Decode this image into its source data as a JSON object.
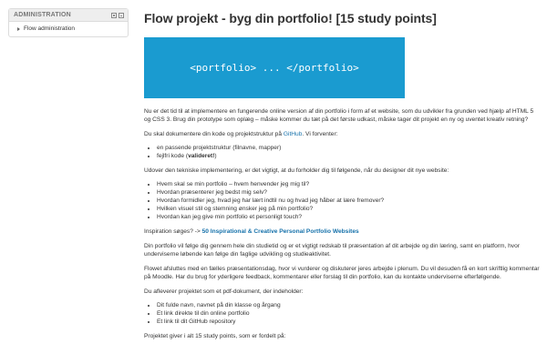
{
  "sidebar": {
    "title": "ADMINISTRATION",
    "dock_icon": "dock-icon",
    "hide_icon": "hide-icon",
    "items": [
      {
        "label": "Flow administration",
        "icon": "triangle-right-icon"
      }
    ]
  },
  "main": {
    "title": "Flow projekt - byg din portfolio! [15 study points]",
    "banner_text": "<portfolio> ... </portfolio>",
    "banner_color": "#1a9bd0",
    "intro": "Nu er det tid til at implementere en fungerende online version af din portfolio i form af et website, som du udvikler fra grunden ved hjælp af HTML 5 og CSS 3. Brug din prototype som oplæg – måske kommer du tæt på det første udkast, måske tager dit projekt en ny og uventet kreativ retning?",
    "doc_before": "Du skal dokumentere din kode og projektstruktur på ",
    "doc_link": "GitHub",
    "doc_after": ". Vi forventer:",
    "expect_items": {
      "item1": "en passende projektstruktur (filnavne, mapper)",
      "item2_pre": "fejlfri kode (",
      "item2_bold": "valideret!",
      "item2_post": ")"
    },
    "design_intro": "Udover den tekniske implementering, er det vigtigt, at du forholder dig til følgende, når du designer dit nye website:",
    "design_questions": [
      "Hvem skal se min portfolio – hvem henvender jeg mig til?",
      "Hvordan præsenterer jeg bedst mig selv?",
      "Hvordan formidler jeg, hvad jeg har lært indtil nu og hvad jeg håber at lære fremover?",
      "Hvilken visuel stil og stemning ønsker jeg på min portfolio?",
      "Hvordan kan jeg give min portfolio et personligt touch?"
    ],
    "inspiration_pre": "Inspiration søges? -> ",
    "inspiration_link": "50 Inspirational & Creative Personal Portfolio Websites",
    "para_tool": "Din portfolio vil følge dig gennem hele din studietid og er et vigtigt redskab til præsentation af dit arbejde og din læring, samt en platform, hvor underviserne løbende kan følge din faglige udvikling og studieaktivitet.",
    "para_presentation": "Flowet afsluttes med en fælles præsentationsdag, hvor vi vurderer og diskuterer jeres arbejde i plenum. Du vil desuden få en kort skriftlig kommentar på Moodle. Har du brug for yderligere feedback, kommentarer eller forslag til din portfolio, kan du kontakte underviserne efterfølgende.",
    "deliver_intro": "Du afleverer projektet som et pdf-dokument, der indeholder:",
    "deliver_items": [
      "Dit fulde navn, navnet på din klasse og årgang",
      "Et link direkte til din online portfolio",
      "Et link til dit GitHub repository"
    ],
    "points_text": "Projektet giver i alt 15 study points, som er fordelt på:"
  }
}
